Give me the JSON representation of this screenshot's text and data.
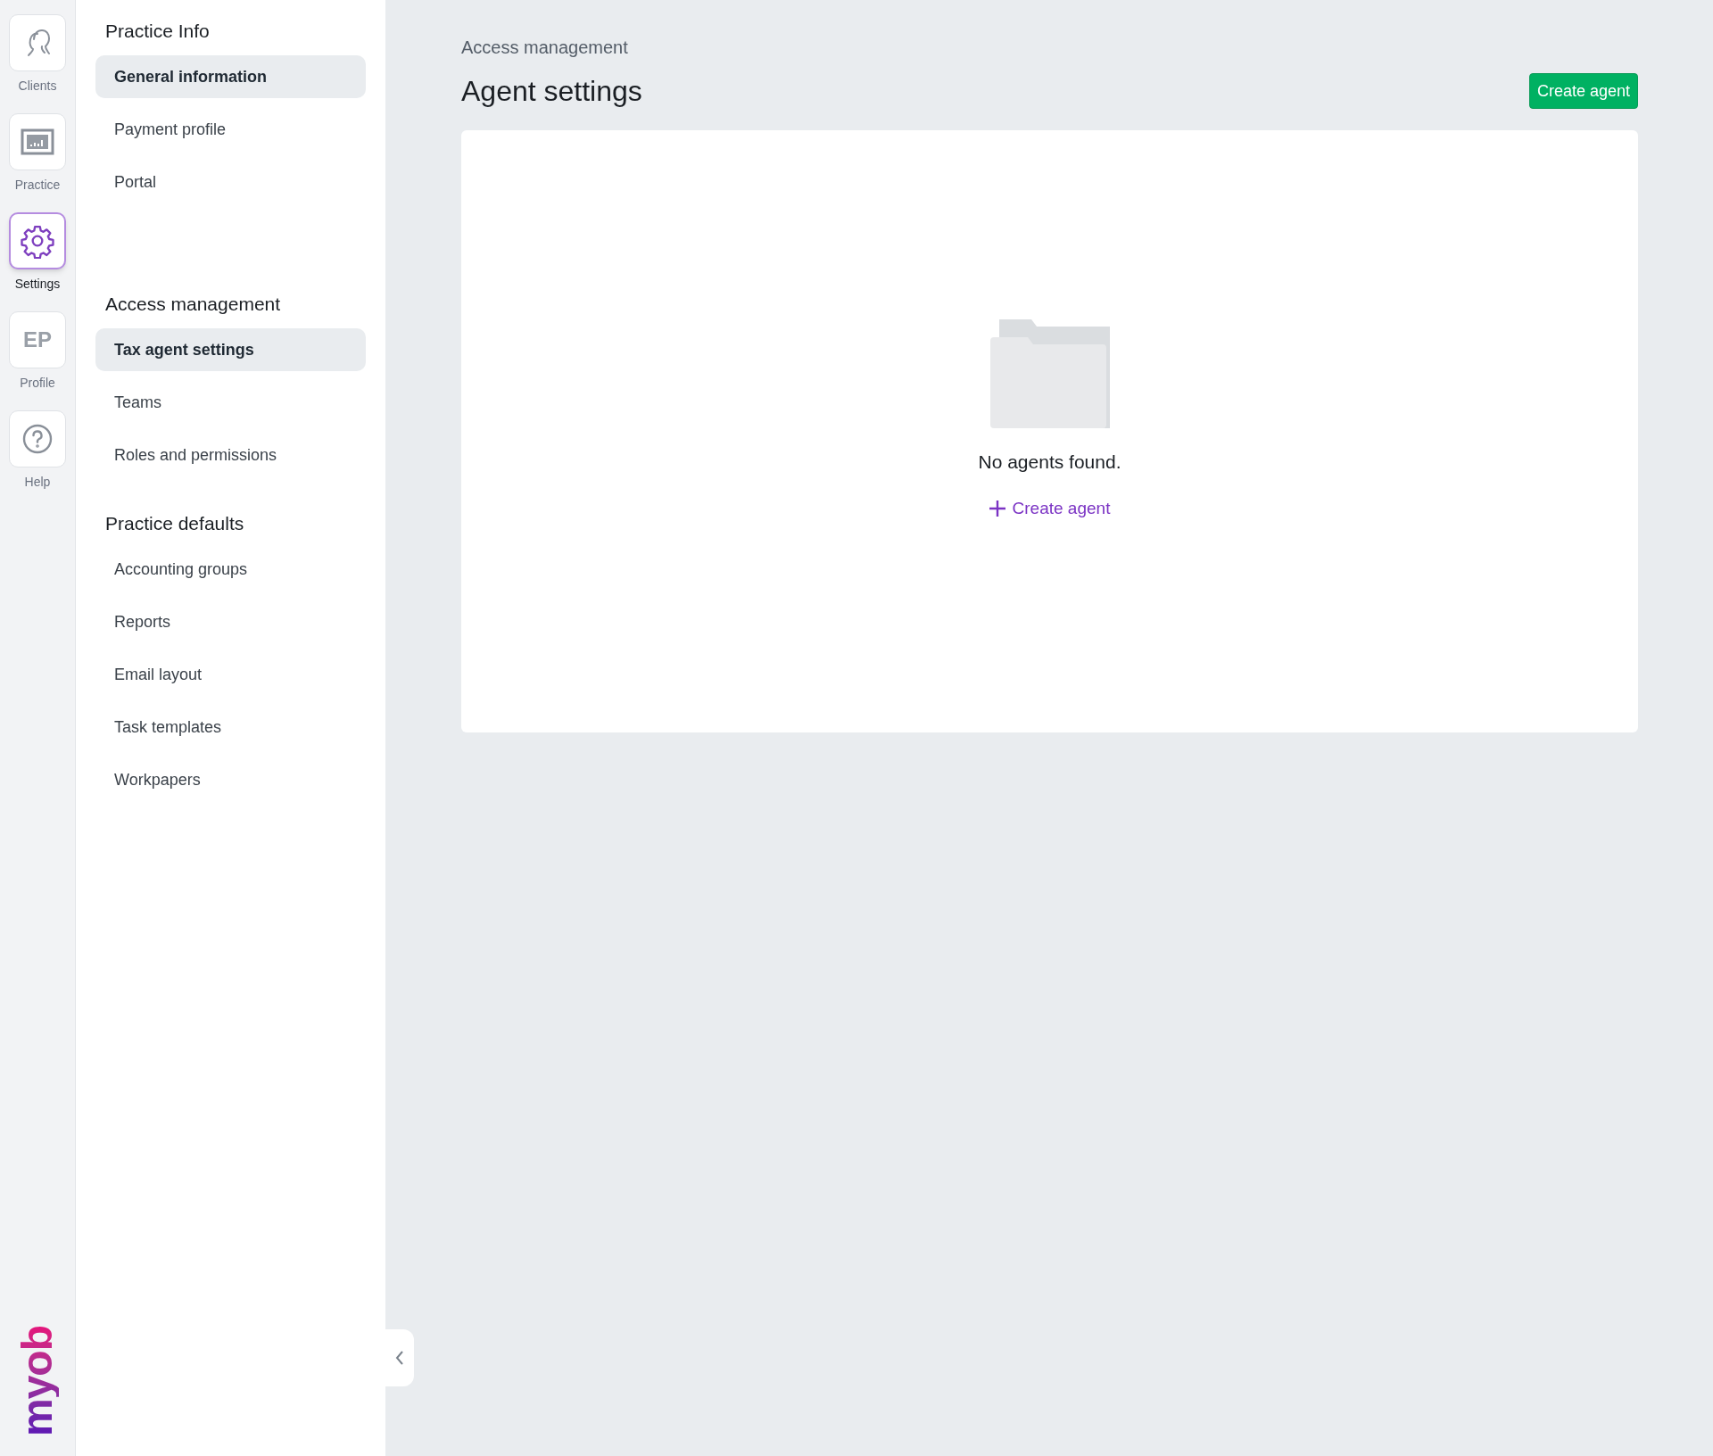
{
  "rail": {
    "items": [
      {
        "kind": "clients",
        "label": "Clients",
        "selected": false
      },
      {
        "kind": "practice",
        "label": "Practice",
        "selected": false
      },
      {
        "kind": "settings",
        "label": "Settings",
        "selected": true
      },
      {
        "kind": "initials",
        "initials": "EP",
        "label": "Profile",
        "selected": false
      },
      {
        "kind": "help",
        "label": "Help",
        "selected": false
      }
    ],
    "logo": "myob"
  },
  "sidebar": {
    "sections": [
      {
        "title": "Practice Info",
        "items": [
          {
            "label": "General information",
            "selected": true
          },
          {
            "label": "Payment profile",
            "selected": false
          },
          {
            "label": "Portal",
            "selected": false
          }
        ]
      },
      {
        "title": "Access management",
        "items": [
          {
            "label": "Tax agent settings",
            "selected": true
          },
          {
            "label": "Teams",
            "selected": false
          },
          {
            "label": "Roles and permissions",
            "selected": false
          }
        ]
      },
      {
        "title": "Practice defaults",
        "items": [
          {
            "label": "Accounting groups",
            "selected": false
          },
          {
            "label": "Reports",
            "selected": false
          },
          {
            "label": "Email layout",
            "selected": false
          },
          {
            "label": "Task templates",
            "selected": false
          },
          {
            "label": "Workpapers",
            "selected": false
          }
        ]
      }
    ]
  },
  "main": {
    "breadcrumb": "Access management",
    "title": "Agent settings",
    "primary_button": "Create agent",
    "empty_state": {
      "message": "No agents found.",
      "link": "Create agent"
    }
  }
}
